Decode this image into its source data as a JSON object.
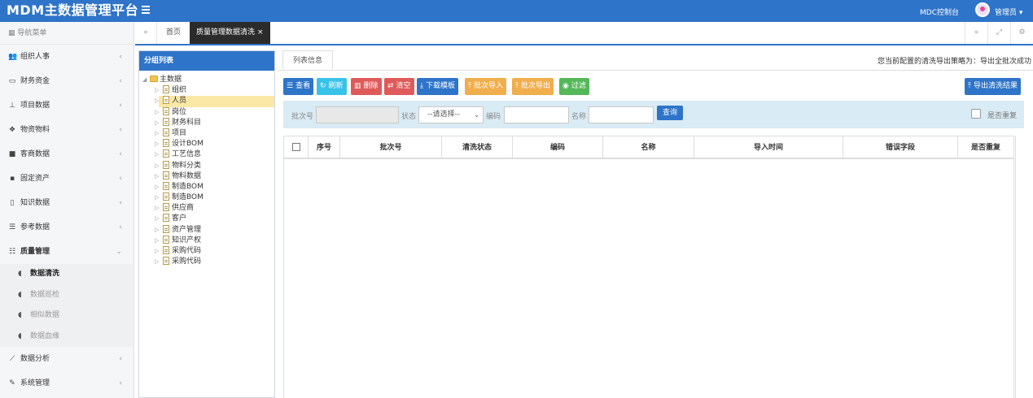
{
  "app": {
    "title": "MDM主数据管理平台",
    "console_link": "MDC控制台",
    "user": "管理员 ▾"
  },
  "sidebar": {
    "header": "导航菜单",
    "items": [
      {
        "label": "组织人事",
        "icon": "users-icon"
      },
      {
        "label": "财务资金",
        "icon": "card-icon"
      },
      {
        "label": "项目数据",
        "icon": "sitemap-icon"
      },
      {
        "label": "物资物料",
        "icon": "cubes-icon"
      },
      {
        "label": "客商数据",
        "icon": "briefcase-icon"
      },
      {
        "label": "固定资产",
        "icon": "archive-icon"
      },
      {
        "label": "知识数据",
        "icon": "file-icon"
      },
      {
        "label": "参考数据",
        "icon": "list-icon"
      },
      {
        "label": "质量管理",
        "icon": "quality-icon",
        "expanded": true
      }
    ],
    "sub_items": [
      {
        "label": "数据清洗",
        "active": true
      },
      {
        "label": "数据巡检"
      },
      {
        "label": "相似数据"
      },
      {
        "label": "数据血缘"
      }
    ],
    "bottom_items": [
      {
        "label": "数据分析",
        "icon": "chart-icon"
      },
      {
        "label": "系统管理",
        "icon": "wrench-icon"
      }
    ]
  },
  "tabs": {
    "home": "首页",
    "active": "质量管理数据清洗",
    "close": "×"
  },
  "group_panel": {
    "title": "分组列表",
    "root": "主数据",
    "children": [
      "组织",
      "人员",
      "岗位",
      "财务科目",
      "项目",
      "设计BOM",
      "工艺信息",
      "物料分类",
      "物料数据",
      "制造BOM",
      "制造BOM",
      "供应商",
      "客户",
      "资产管理",
      "知识产权",
      "采购代码",
      "采购代码"
    ],
    "selected_index": 1
  },
  "main": {
    "tab_label": "列表信息",
    "policy_text": "您当前配置的清洗导出策略为：导出全批次成功",
    "buttons": {
      "view": "查看",
      "refresh": "刷新",
      "delete": "删除",
      "clear": "清空",
      "download": "下载模板",
      "import": "批次导入",
      "export": "批次导出",
      "filter": "过滤",
      "export_result": "导出清洗结果"
    },
    "search": {
      "batch_label": "批次号",
      "status_label": "状态",
      "status_value": "--请选择--",
      "code_label": "编码",
      "name_label": "名称",
      "query": "查询",
      "dup_label": "是否重复"
    },
    "table": {
      "columns": [
        "序号",
        "批次号",
        "清洗状态",
        "编码",
        "名称",
        "导入时间",
        "错误字段",
        "是否重复"
      ]
    }
  },
  "colors": {
    "primary": "#2e74c9",
    "danger": "#df5a5a",
    "warning": "#f0ae4c",
    "success": "#55b858",
    "info": "#39c2e8"
  }
}
